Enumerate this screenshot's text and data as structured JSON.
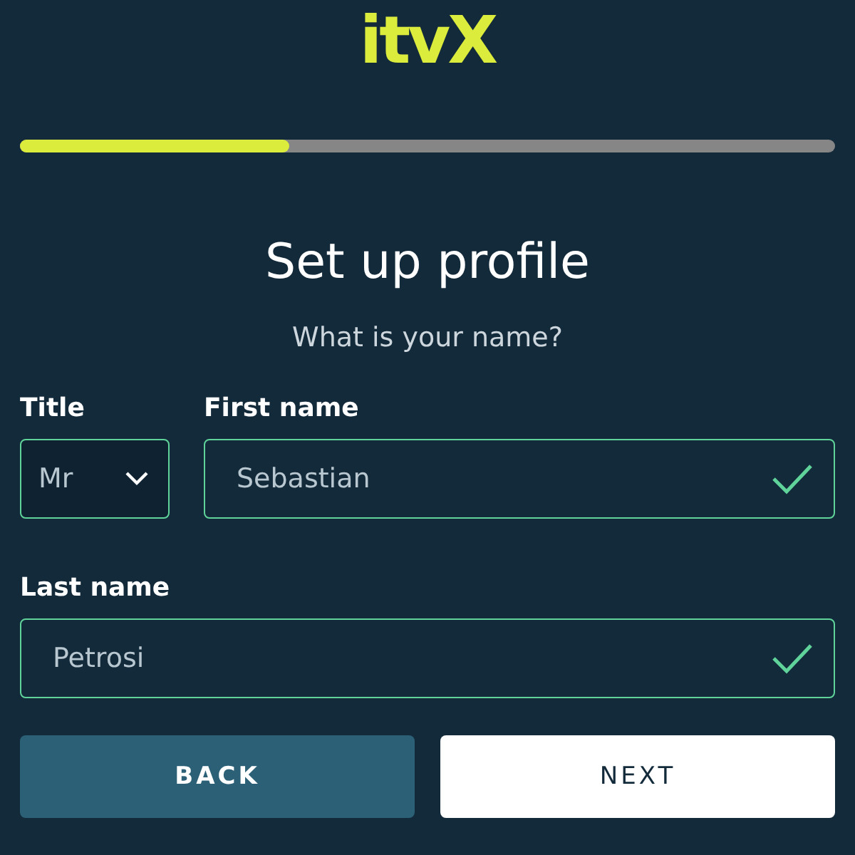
{
  "logo": "itvX",
  "progress": {
    "level": 0.33
  },
  "heading": "Set up profile",
  "subtitle": "What is your name?",
  "title_field": {
    "label": "Title",
    "value": "Mr"
  },
  "first_name": {
    "label": "First name",
    "value": "Sebastian",
    "valid": true
  },
  "last_name": {
    "label": "Last name",
    "value": "Petrosi",
    "valid": true
  },
  "buttons": [
    {
      "label": "BACK",
      "kind": "secondary"
    },
    {
      "label": "NEXT",
      "kind": "primary"
    }
  ]
}
